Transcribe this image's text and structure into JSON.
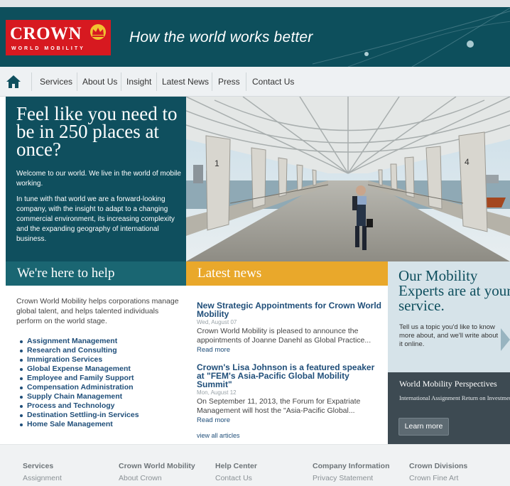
{
  "header": {
    "logo_word": "CROWN",
    "logo_sub": "WORLD MOBILITY",
    "tagline": "How the world works better"
  },
  "nav": {
    "items": [
      "Services",
      "About Us",
      "Insight",
      "Latest News",
      "Press",
      "Contact Us"
    ]
  },
  "hero": {
    "heading": "Feel like you need to be in 250 places at once?",
    "p1": "Welcome to our world. We live in the world of mobile working.",
    "p2": "In tune with that world we are a forward-looking company, with the insight to adapt to a changing commercial environment, its increasing complexity and the expanding geography of international business.",
    "pillar_left": "1",
    "pillar_right": "4"
  },
  "help": {
    "title": "We're here to help",
    "intro": "Crown World Mobility helps corporations manage global talent, and helps talented individuals perform on the world stage.",
    "items": [
      "Assignment Management",
      "Research and Consulting",
      "Immigration Services",
      "Global Expense Management",
      "Employee and Family Support",
      "Compensation Administration",
      "Supply Chain Management",
      "Process and Technology",
      "Destination Settling-in Services",
      "Home Sale Management"
    ]
  },
  "news": {
    "title": "Latest news",
    "articles": [
      {
        "title": "New Strategic Appointments for Crown World Mobility",
        "date": "Wed, August 07",
        "body": "Crown World Mobility is pleased to announce the appointments of Joanne Danehl as Global Practice...",
        "more": "Read more"
      },
      {
        "title": "Crown's Lisa Johnson is a featured speaker at \"FEM's Asia-Pacific Global Mobility Summit\"",
        "date": "Mon, August 12",
        "body": "On September 11, 2013, the Forum for Expatriate Management will host the \"Asia-Pacific Global...",
        "more": "Read more"
      }
    ],
    "view_all": "view all articles"
  },
  "experts": {
    "title": "Our Mobility Experts are at your service.",
    "body": "Tell us a topic you'd like to know more about, and we'll write about it online."
  },
  "perspectives": {
    "title": "World Mobility Perspectives",
    "subtitle": "International Assignment Return on Investment",
    "button": "Learn more"
  },
  "footer": {
    "columns": [
      {
        "head": "Services",
        "link": "Assignment"
      },
      {
        "head": "Crown World Mobility",
        "link": "About Crown"
      },
      {
        "head": "Help Center",
        "link": "Contact Us"
      },
      {
        "head": "Company Information",
        "link": "Privacy Statement"
      },
      {
        "head": "Crown Divisions",
        "link": "Crown Fine Art"
      }
    ]
  },
  "colors": {
    "brand_teal": "#0f4f5e",
    "brand_red": "#d71920",
    "news_orange": "#e9a82b",
    "link_blue": "#1f4e79"
  },
  "icons": [
    "home-icon",
    "crown-emblem-icon",
    "arrow-right-icon"
  ]
}
